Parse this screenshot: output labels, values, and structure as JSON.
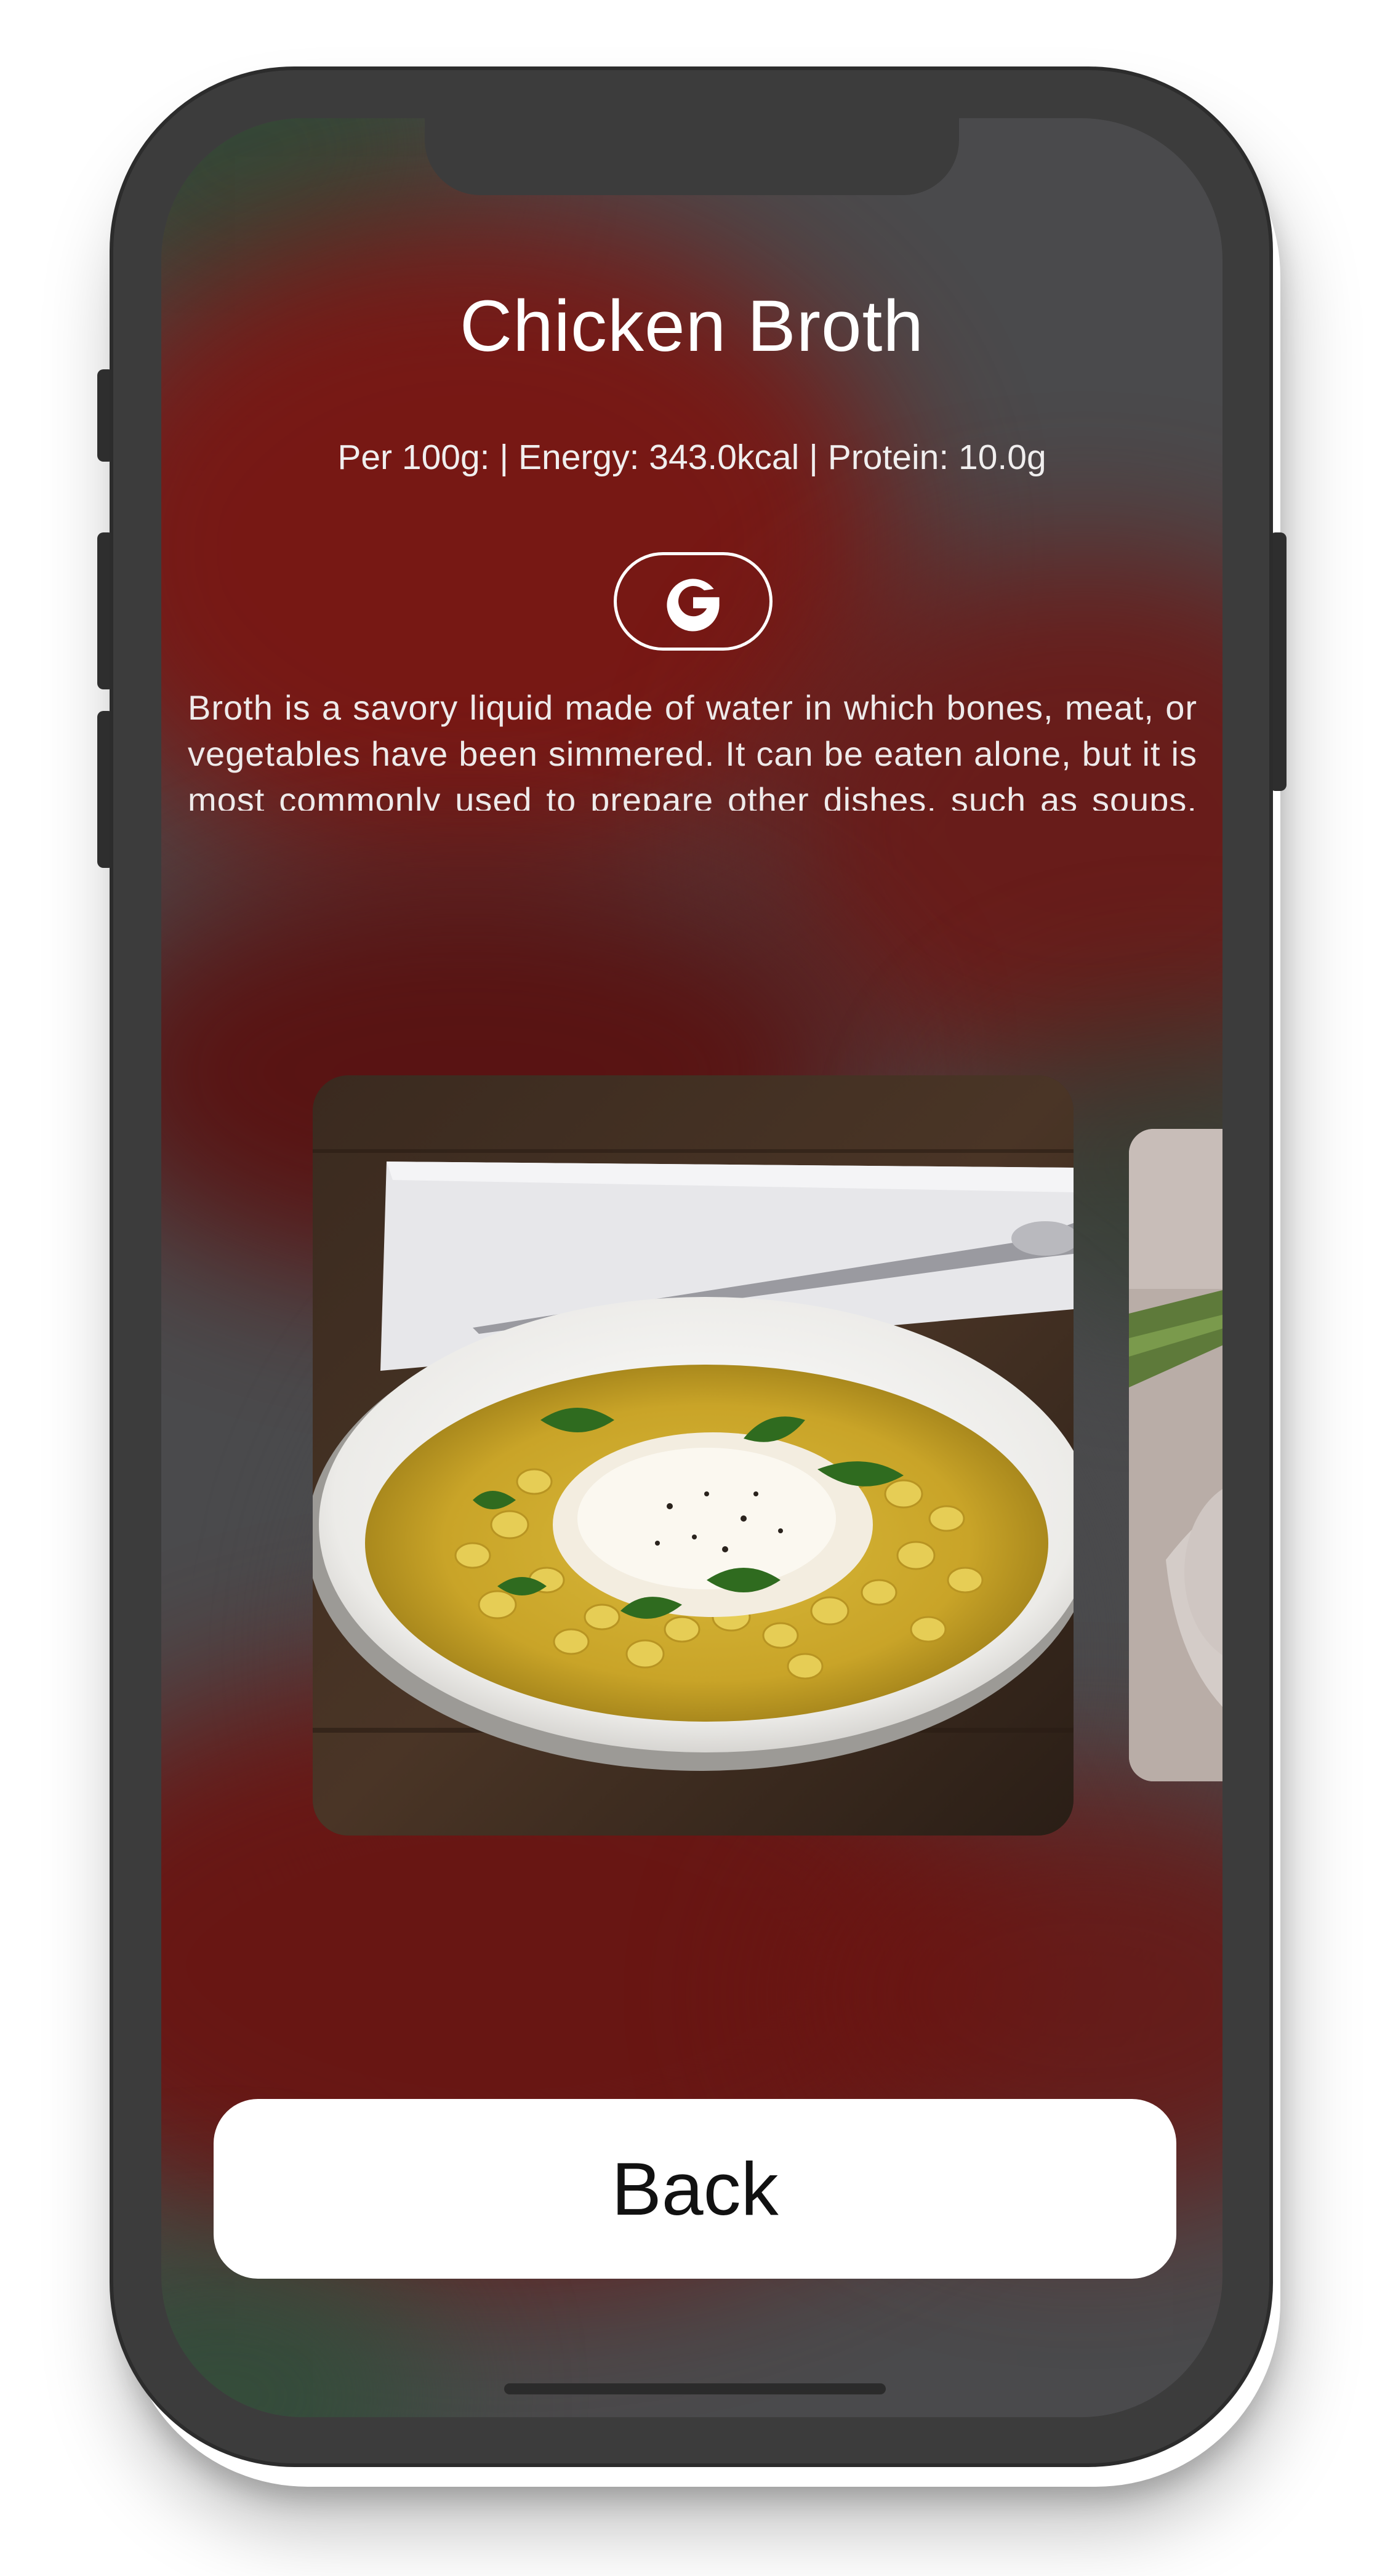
{
  "recipe": {
    "title": "Chicken Broth",
    "nutrition_summary": "Per 100g: | Energy: 343.0kcal | Protein: 10.0g",
    "description": "Broth is a savory liquid made of water in which bones, meat, or vegetables have been simmered. It can be eaten alone, but it is most commonly used to prepare other dishes, such as soups, gravies, and sauces."
  },
  "google_search": {
    "icon": "google-icon"
  },
  "carousel": {
    "images": [
      {
        "name": "pasta-soup-bowl"
      },
      {
        "name": "next-dish-partial"
      }
    ]
  },
  "actions": {
    "back_label": "Back"
  },
  "colors": {
    "background_red": "#7a1612",
    "background_gray": "#4a4a4c",
    "button_background": "#ffffff",
    "text_light": "#ffffff",
    "phone_frame": "#3c3c3c"
  }
}
